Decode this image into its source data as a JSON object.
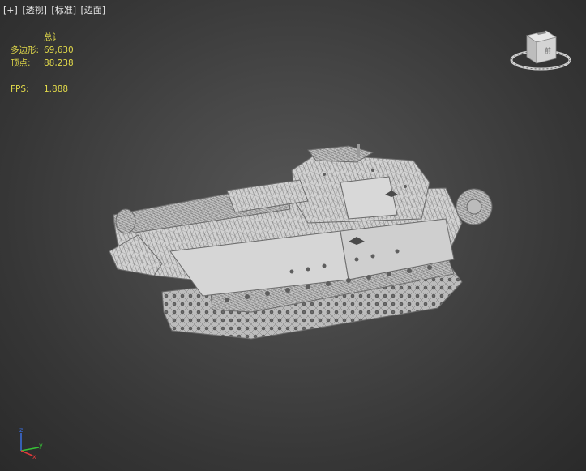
{
  "viewport": {
    "menu": {
      "plus": "[+]",
      "view": "[透视]",
      "shading_mode": "[标准]",
      "display": "[边面]"
    },
    "stats": {
      "header": "总计",
      "polygons_label": "多边形:",
      "polygons_value": "69,630",
      "vertices_label": "顶点:",
      "vertices_value": "88,238",
      "fps_label": "FPS:",
      "fps_value": "1.888"
    },
    "colors": {
      "stats_text": "#e0d84a",
      "menu_text": "#e8e8e8",
      "wireframe_fill": "#d2d2d2",
      "wireframe_edges": "#7a7a7a"
    },
    "icons": [
      "viewcube-icon",
      "axis-gizmo-icon"
    ]
  }
}
